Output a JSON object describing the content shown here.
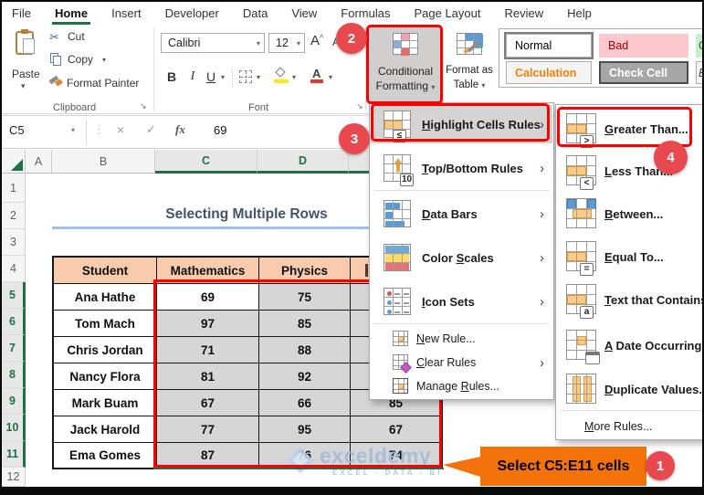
{
  "window": {
    "tabs": [
      "File",
      "Home",
      "Insert",
      "Developer",
      "Data",
      "View",
      "Formulas",
      "Page Layout",
      "Review",
      "Help"
    ],
    "active_tab": "Home"
  },
  "ribbon": {
    "clipboard": {
      "group_label": "Clipboard",
      "paste_label": "Paste",
      "cut_label": "Cut",
      "copy_label": "Copy",
      "format_painter_label": "Format Painter"
    },
    "font_group": {
      "group_label": "Font",
      "font_name": "Calibri",
      "font_size": "12",
      "bold_label": "B",
      "italic_label": "I",
      "underline_label": "U"
    },
    "conditional_formatting": {
      "line1": "Conditional",
      "line2": "Formatting"
    },
    "format_as_table": {
      "line1": "Format as",
      "line2": "Table"
    },
    "cell_styles": {
      "normal": "Normal",
      "bad": "Bad",
      "good_partial": "G",
      "calculation": "Calculation",
      "check_cell": "Check Cell",
      "explanatory_partial": "E"
    }
  },
  "formula_bar": {
    "name_box": "C5",
    "fx_label": "fx",
    "value": "69"
  },
  "sheet": {
    "col_headers": [
      "A",
      "B",
      "C",
      "D",
      ""
    ],
    "row_numbers": [
      "1",
      "2",
      "3",
      "4",
      "5",
      "6",
      "7",
      "8",
      "9",
      "10",
      "11",
      "12"
    ],
    "title": "Selecting Multiple Rows",
    "table": {
      "headers": {
        "student": "Student",
        "mathematics": "Mathematics",
        "physics": "Physics",
        "col_e": ""
      },
      "rows": [
        {
          "student": "Ana Hathe",
          "mathematics": "69",
          "physics": "75",
          "col_e": ""
        },
        {
          "student": "Tom Mach",
          "mathematics": "97",
          "physics": "85",
          "col_e": ""
        },
        {
          "student": "Chris Jordan",
          "mathematics": "71",
          "physics": "88",
          "col_e": ""
        },
        {
          "student": "Nancy Flora",
          "mathematics": "81",
          "physics": "92",
          "col_e": ""
        },
        {
          "student": "Mark Buam",
          "mathematics": "67",
          "physics": "66",
          "col_e": "85"
        },
        {
          "student": "Jack Harold",
          "mathematics": "77",
          "physics": "95",
          "col_e": "67"
        },
        {
          "student": "Ema Gomes",
          "mathematics": "87",
          "physics": "76",
          "col_e": "74"
        }
      ]
    }
  },
  "cf_menu": {
    "items": [
      {
        "pre": "",
        "key": "H",
        "post": "ighlight Cells Rules",
        "badge": "≤"
      },
      {
        "pre": "",
        "key": "T",
        "post": "op/Bottom Rules",
        "badge": "10"
      },
      {
        "pre": "",
        "key": "D",
        "post": "ata Bars"
      },
      {
        "pre": "Color ",
        "key": "S",
        "post": "cales"
      },
      {
        "pre": "",
        "key": "I",
        "post": "con Sets"
      },
      {
        "pre": "",
        "key": "N",
        "post": "ew Rule..."
      },
      {
        "pre": "",
        "key": "C",
        "post": "lear Rules"
      },
      {
        "pre": "Manage ",
        "key": "R",
        "post": "ules..."
      }
    ]
  },
  "cf_submenu": {
    "items": [
      {
        "pre": "",
        "key": "G",
        "post": "reater Than...",
        "badge": ">"
      },
      {
        "pre": "",
        "key": "L",
        "post": "ess Than...",
        "badge": "<"
      },
      {
        "pre": "",
        "key": "B",
        "post": "etween..."
      },
      {
        "pre": "",
        "key": "E",
        "post": "qual To...",
        "badge": "="
      },
      {
        "pre": "",
        "key": "T",
        "post": "ext that Contains...",
        "badge": "a"
      },
      {
        "pre": "",
        "key": "A",
        "post": " Date Occurring..."
      },
      {
        "pre": "",
        "key": "D",
        "post": "uplicate Values..."
      },
      {
        "pre": "",
        "key": "M",
        "post": "ore Rules..."
      }
    ]
  },
  "annotations": {
    "step1": "1",
    "step2": "2",
    "step3": "3",
    "step4": "4",
    "callout_text": "Select C5:E11 cells"
  },
  "watermark": {
    "brand": "exceldemy",
    "tagline": "EXCEL - DATA - BI"
  },
  "colors": {
    "excel_green": "#1E7145",
    "annotation_red": "#FF0000",
    "circle_red": "#E8494E",
    "callout_orange": "#F4720A",
    "header_fill": "#F8CBAD",
    "selection_gray": "#D6D6D6",
    "title_color": "#44546A",
    "title_underline": "#9DC3E6",
    "watermark_blue": "#A9C2DE"
  }
}
